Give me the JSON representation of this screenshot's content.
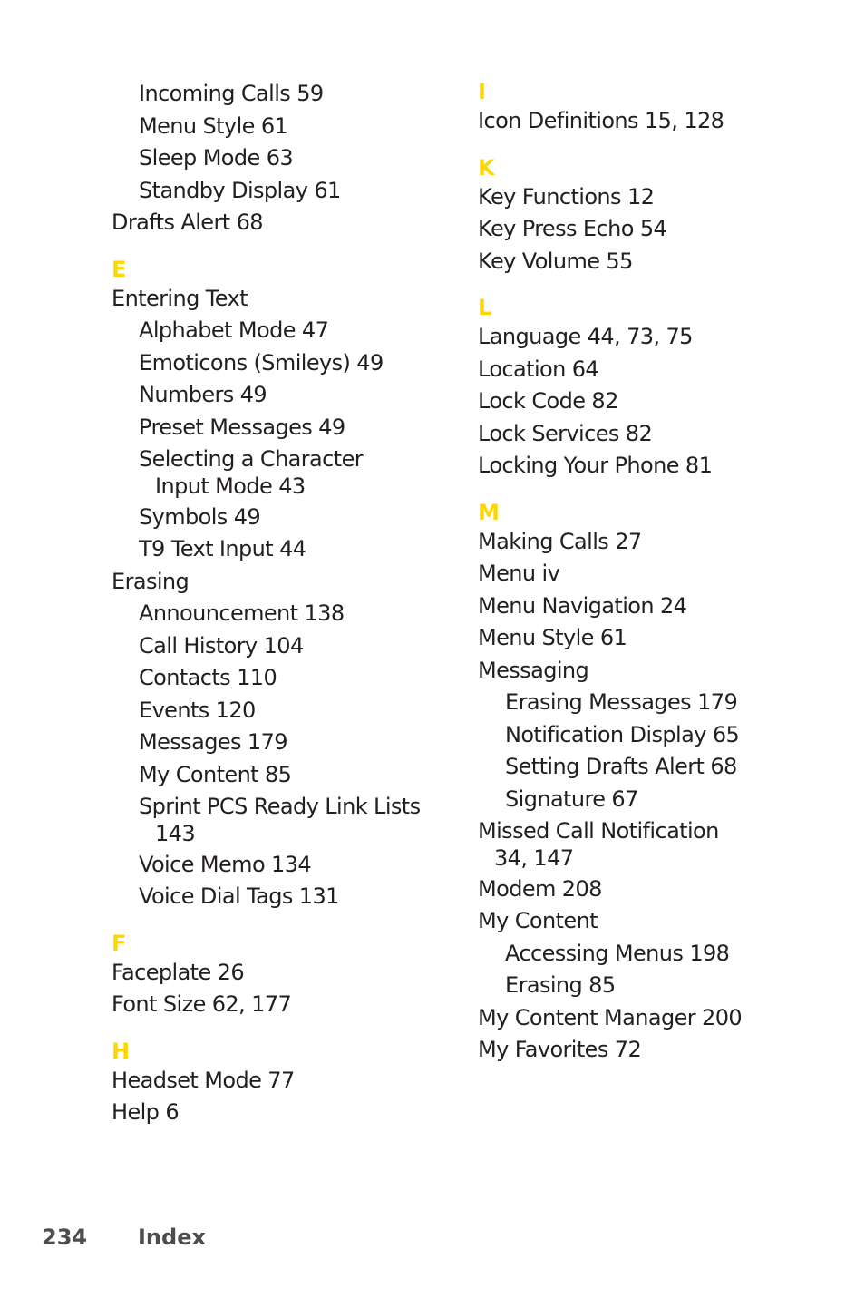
{
  "accent_color": "#ffd700",
  "left_column": [
    {
      "type": "entry",
      "level": 1,
      "text": "Incoming Calls 59"
    },
    {
      "type": "entry",
      "level": 1,
      "text": "Menu Style 61"
    },
    {
      "type": "entry",
      "level": 1,
      "text": "Sleep Mode 63"
    },
    {
      "type": "entry",
      "level": 1,
      "text": "Standby Display 61"
    },
    {
      "type": "entry",
      "level": 0,
      "text": "Drafts Alert 68"
    },
    {
      "type": "letter",
      "text": "E"
    },
    {
      "type": "entry",
      "level": 0,
      "text": "Entering Text"
    },
    {
      "type": "entry",
      "level": 1,
      "text": "Alphabet Mode 47"
    },
    {
      "type": "entry",
      "level": 1,
      "text": "Emoticons (Smileys) 49"
    },
    {
      "type": "entry",
      "level": 1,
      "text": "Numbers 49"
    },
    {
      "type": "entry",
      "level": 1,
      "text": "Preset Messages 49"
    },
    {
      "type": "entry",
      "level": 1,
      "text": "Selecting a Character"
    },
    {
      "type": "entry",
      "level": "cont",
      "text": "Input Mode 43"
    },
    {
      "type": "entry",
      "level": 1,
      "text": "Symbols 49"
    },
    {
      "type": "entry",
      "level": 1,
      "text": "T9 Text Input 44"
    },
    {
      "type": "entry",
      "level": 0,
      "text": "Erasing"
    },
    {
      "type": "entry",
      "level": 1,
      "text": "Announcement 138"
    },
    {
      "type": "entry",
      "level": 1,
      "text": "Call History 104"
    },
    {
      "type": "entry",
      "level": 1,
      "text": "Contacts 110"
    },
    {
      "type": "entry",
      "level": 1,
      "text": "Events 120"
    },
    {
      "type": "entry",
      "level": 1,
      "text": "Messages 179"
    },
    {
      "type": "entry",
      "level": 1,
      "text": "My Content 85"
    },
    {
      "type": "entry",
      "level": 1,
      "text": "Sprint PCS Ready Link Lists"
    },
    {
      "type": "entry",
      "level": "cont",
      "text": "143"
    },
    {
      "type": "entry",
      "level": 1,
      "text": "Voice Memo 134"
    },
    {
      "type": "entry",
      "level": 1,
      "text": "Voice Dial Tags 131"
    },
    {
      "type": "letter",
      "text": "F"
    },
    {
      "type": "entry",
      "level": 0,
      "text": "Faceplate 26"
    },
    {
      "type": "entry",
      "level": 0,
      "text": "Font Size  62, 177"
    },
    {
      "type": "letter",
      "text": "H"
    },
    {
      "type": "entry",
      "level": 0,
      "text": "Headset Mode 77"
    },
    {
      "type": "entry",
      "level": 0,
      "text": "Help 6"
    }
  ],
  "right_column": [
    {
      "type": "letter",
      "text": "I"
    },
    {
      "type": "entry",
      "level": 0,
      "text": "Icon Definitions 15, 128"
    },
    {
      "type": "letter",
      "text": "K"
    },
    {
      "type": "entry",
      "level": 0,
      "text": "Key Functions 12"
    },
    {
      "type": "entry",
      "level": 0,
      "text": "Key Press Echo 54"
    },
    {
      "type": "entry",
      "level": 0,
      "text": "Key Volume 55"
    },
    {
      "type": "letter",
      "text": "L"
    },
    {
      "type": "entry",
      "level": 0,
      "text": "Language 44, 73, 75"
    },
    {
      "type": "entry",
      "level": 0,
      "text": "Location 64"
    },
    {
      "type": "entry",
      "level": 0,
      "text": "Lock Code 82"
    },
    {
      "type": "entry",
      "level": 0,
      "text": "Lock Services 82"
    },
    {
      "type": "entry",
      "level": 0,
      "text": "Locking Your Phone 81"
    },
    {
      "type": "letter",
      "text": "M"
    },
    {
      "type": "entry",
      "level": 0,
      "text": "Making Calls 27"
    },
    {
      "type": "entry",
      "level": 0,
      "text": "Menu iv"
    },
    {
      "type": "entry",
      "level": 0,
      "text": "Menu Navigation 24"
    },
    {
      "type": "entry",
      "level": 0,
      "text": "Menu Style 61"
    },
    {
      "type": "entry",
      "level": 0,
      "text": "Messaging"
    },
    {
      "type": "entry",
      "level": 1,
      "text": "Erasing Messages 179"
    },
    {
      "type": "entry",
      "level": 1,
      "text": "Notification Display 65"
    },
    {
      "type": "entry",
      "level": 1,
      "text": "Setting Drafts Alert 68"
    },
    {
      "type": "entry",
      "level": 1,
      "text": "Signature 67"
    },
    {
      "type": "entry",
      "level": 0,
      "text": "Missed Call Notification"
    },
    {
      "type": "entry",
      "level": "cont0",
      "text": "34, 147"
    },
    {
      "type": "entry",
      "level": 0,
      "text": "Modem 208"
    },
    {
      "type": "entry",
      "level": 0,
      "text": "My Content"
    },
    {
      "type": "entry",
      "level": 1,
      "text": "Accessing Menus 198"
    },
    {
      "type": "entry",
      "level": 1,
      "text": "Erasing 85"
    },
    {
      "type": "entry",
      "level": 0,
      "text": "My Content Manager 200"
    },
    {
      "type": "entry",
      "level": 0,
      "text": "My Favorites 72"
    }
  ],
  "footer": {
    "page_number": "234",
    "section_title": "Index"
  }
}
